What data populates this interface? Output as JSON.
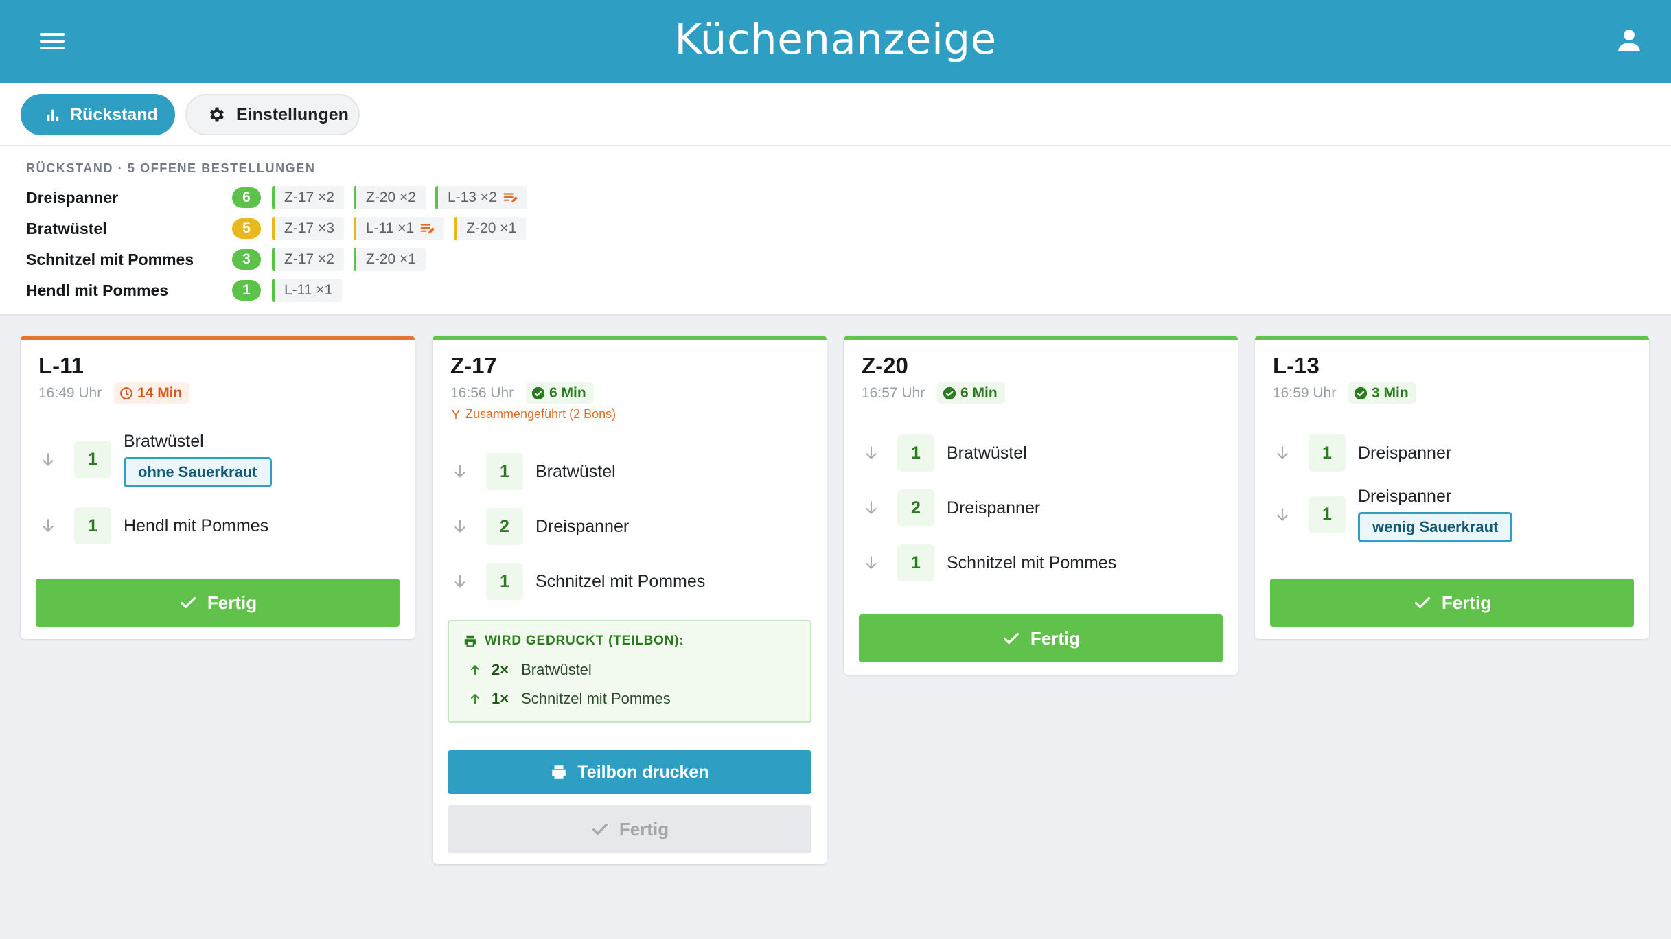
{
  "app": {
    "title": "Küchenanzeige"
  },
  "toolbar": {
    "backlog_label": "Rückstand",
    "settings_label": "Einstellungen"
  },
  "colors": {
    "header": "#2e9fc3",
    "ok": "#60c24a",
    "late": "#e8742e",
    "warn": "#e8b91e"
  },
  "backlog": {
    "heading": "RÜCKSTAND · 5 OFFENE BESTELLUNGEN",
    "rows": [
      {
        "name": "Dreispanner",
        "count": "6",
        "count_color": "#5cc24a",
        "chips": [
          {
            "label": "Z-17 ×2",
            "note": false
          },
          {
            "label": "Z-20 ×2",
            "note": false
          },
          {
            "label": "L-13 ×2",
            "note": true
          }
        ]
      },
      {
        "name": "Bratwüstel",
        "count": "5",
        "count_color": "#e8b91e",
        "chips": [
          {
            "label": "Z-17 ×3",
            "note": false
          },
          {
            "label": "L-11 ×1",
            "note": true
          },
          {
            "label": "Z-20 ×1",
            "note": false
          }
        ]
      },
      {
        "name": "Schnitzel mit Pommes",
        "count": "3",
        "count_color": "#5cc24a",
        "chips": [
          {
            "label": "Z-17 ×2",
            "note": false
          },
          {
            "label": "Z-20 ×1",
            "note": false
          }
        ]
      },
      {
        "name": "Hendl mit Pommes",
        "count": "1",
        "count_color": "#5cc24a",
        "chips": [
          {
            "label": "L-11 ×1",
            "note": false
          }
        ]
      }
    ]
  },
  "orders": [
    {
      "id": "L-11",
      "time": "16:49 Uhr",
      "age": "14 Min",
      "status": "late",
      "items": [
        {
          "qty": "1",
          "name": "Bratwüstel",
          "modifier": "ohne Sauerkraut"
        },
        {
          "qty": "1",
          "name": "Hendl mit Pommes",
          "modifier": ""
        }
      ],
      "done_label": "Fertig"
    },
    {
      "id": "Z-17",
      "time": "16:56 Uhr",
      "age": "6 Min",
      "status": "ok",
      "merged_note": "Zusammengeführt (2 Bons)",
      "items": [
        {
          "qty": "1",
          "name": "Bratwüstel",
          "modifier": ""
        },
        {
          "qty": "2",
          "name": "Dreispanner",
          "modifier": ""
        },
        {
          "qty": "1",
          "name": "Schnitzel mit Pommes",
          "modifier": ""
        }
      ],
      "printing": {
        "heading": "WIRD GEDRUCKT (TEILBON):",
        "items": [
          {
            "qty": "2×",
            "name": "Bratwüstel"
          },
          {
            "qty": "1×",
            "name": "Schnitzel mit Pommes"
          }
        ]
      },
      "print_label": "Teilbon drucken",
      "done_label": "Fertig"
    },
    {
      "id": "Z-20",
      "time": "16:57 Uhr",
      "age": "6 Min",
      "status": "ok",
      "items": [
        {
          "qty": "1",
          "name": "Bratwüstel",
          "modifier": ""
        },
        {
          "qty": "2",
          "name": "Dreispanner",
          "modifier": ""
        },
        {
          "qty": "1",
          "name": "Schnitzel mit Pommes",
          "modifier": ""
        }
      ],
      "done_label": "Fertig"
    },
    {
      "id": "L-13",
      "time": "16:59 Uhr",
      "age": "3 Min",
      "status": "ok",
      "items": [
        {
          "qty": "1",
          "name": "Dreispanner",
          "modifier": ""
        },
        {
          "qty": "1",
          "name": "Dreispanner",
          "modifier": "wenig Sauerkraut"
        }
      ],
      "done_label": "Fertig"
    }
  ]
}
